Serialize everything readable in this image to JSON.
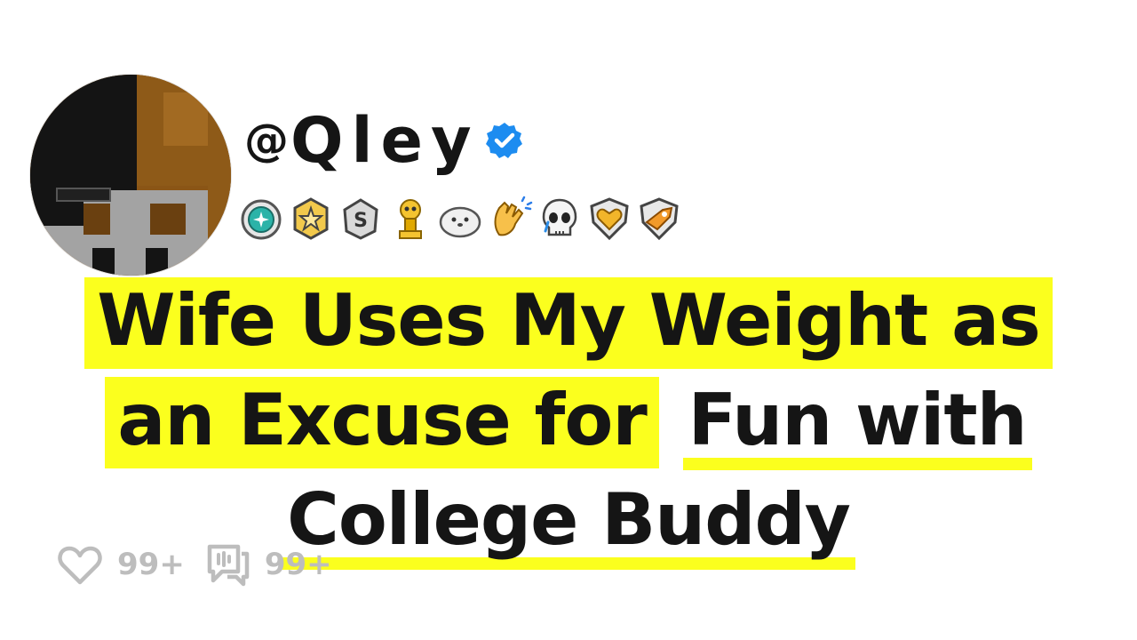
{
  "profile": {
    "at_sign": "@",
    "handle": "Qley",
    "verified": true,
    "avatar_icon": "pixel-avatar",
    "verified_icon": "verified-badge-icon"
  },
  "awards": [
    "teal-medal-icon",
    "gold-star-medal-icon",
    "silver-s-medal-icon",
    "gold-trophy-icon",
    "seal-icon",
    "clapping-hands-icon",
    "crying-skull-icon",
    "gold-heart-shield-icon",
    "gold-rocket-shield-icon"
  ],
  "headline": {
    "highlighted_1": "Wife Uses My Weight as",
    "highlighted_2": "an Excuse for",
    "underlined_1": "Fun with",
    "underlined_2": "College Buddy"
  },
  "stats": {
    "likes": "99+",
    "comments": "99+",
    "like_icon": "heart-icon",
    "comment_icon": "comment-icon"
  },
  "colors": {
    "highlight": "#fbff1e",
    "text": "#151515",
    "muted": "#bdbdbd",
    "verified": "#1d8cf0"
  }
}
